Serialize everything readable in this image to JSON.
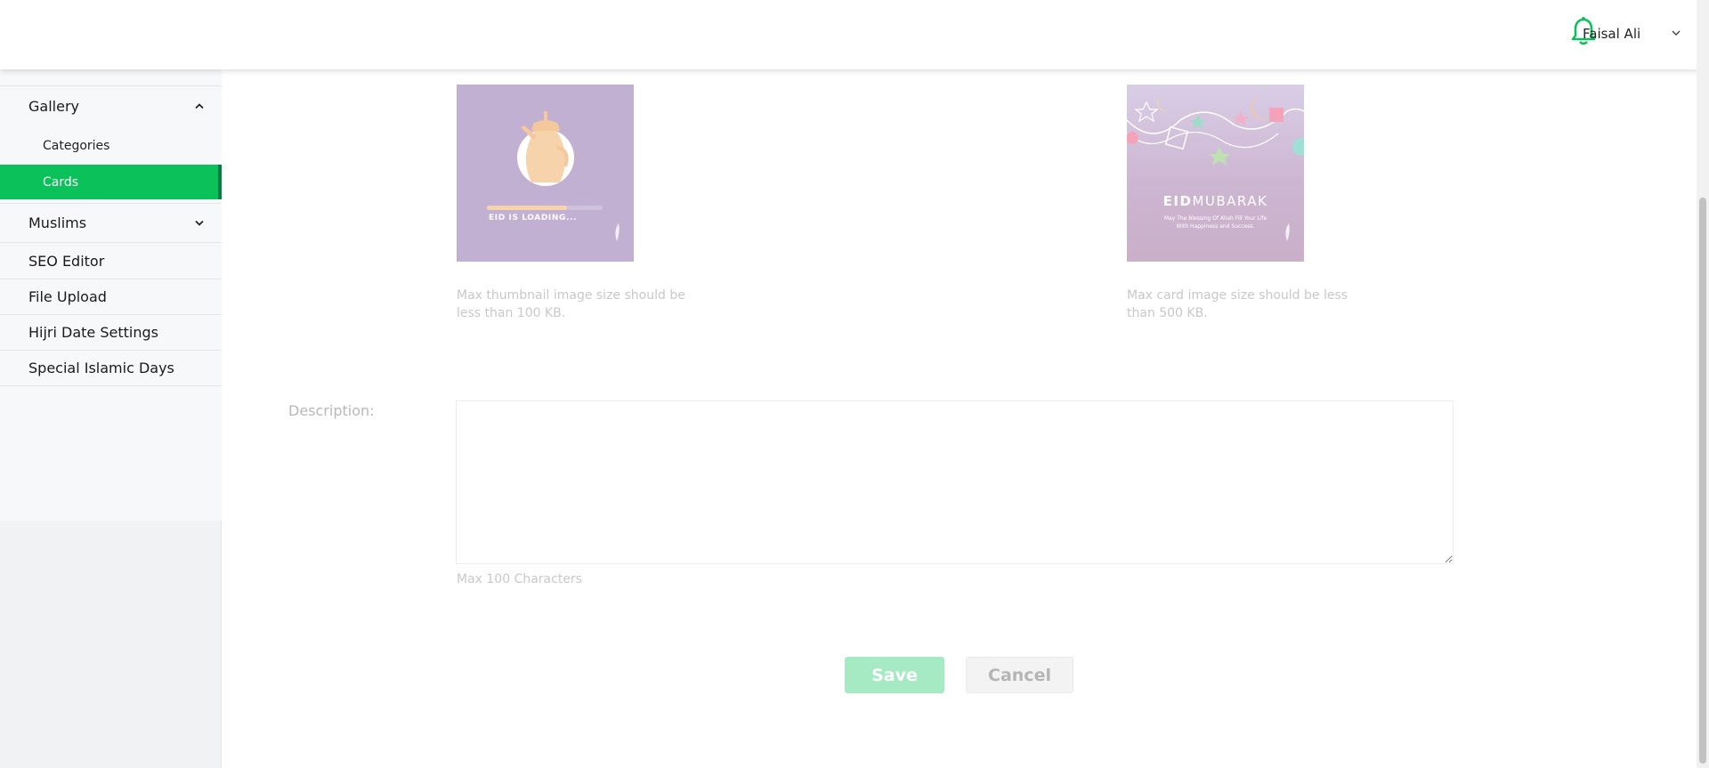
{
  "header": {
    "user_name": "Faisal Ali",
    "notification_icon": "bell-icon",
    "user_menu_icon": "chevron-down-icon"
  },
  "sidebar": {
    "gallery": {
      "label": "Gallery",
      "icon": "chevron-up-icon",
      "expanded": true
    },
    "gallery_items": [
      {
        "label": "Categories",
        "active": false
      },
      {
        "label": "Cards",
        "active": true
      }
    ],
    "muslims": {
      "label": "Muslims",
      "icon": "chevron-down-icon"
    },
    "items": [
      {
        "label": "SEO Editor"
      },
      {
        "label": "File Upload"
      },
      {
        "label": "Hijri Date Settings"
      },
      {
        "label": "Special Islamic Days"
      }
    ]
  },
  "form": {
    "thumbnail": {
      "image_text": "EID IS LOADING...",
      "hint": "Max thumbnail image size should be less than 100 KB."
    },
    "card": {
      "image_title_1": "EID",
      "image_title_2": "MUBARAK",
      "image_sub_1": "May The Blessing Of Allah Fill Your Life",
      "image_sub_2": "With Happiness and Success.",
      "hint": "Max card image size should be less than 500 KB."
    },
    "description_label": "Description:",
    "description_value": "",
    "max_chars": "Max 100 Characters",
    "save_label": "Save",
    "cancel_label": "Cancel"
  },
  "colors": {
    "accent": "#0bc25a",
    "accent_dark": "#0a7a43",
    "save_disabled": "#a6eac3",
    "thumb_bg": "#c1b0d1"
  }
}
